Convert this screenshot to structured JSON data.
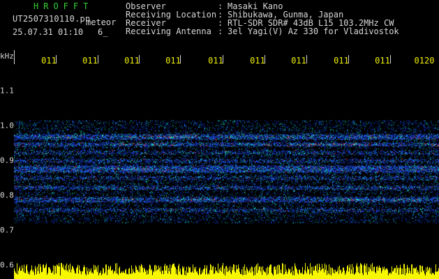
{
  "header": {
    "logo": "HROFFT",
    "filename": "UT2507310110.pn",
    "meteor": "meteor",
    "datetime": "25.07.31 01:10",
    "mark": "6_"
  },
  "info": [
    {
      "label": "Observer",
      "colon": ":",
      "value": "Masaki Kano"
    },
    {
      "label": "Receiving Location",
      "colon": ":",
      "value": "Shibukawa, Gunma, Japan"
    },
    {
      "label": "Receiver",
      "colon": ":",
      "value": "RTL-SDR SDR# 43dB L15 103.2MHz CW"
    },
    {
      "label": "Receiving Antenna",
      "colon": ":",
      "value": "3el Yagi(V) Az 330 for Vladivostok"
    }
  ],
  "time_labels": [
    "011",
    "011",
    "011",
    "011",
    "011",
    "011",
    "011",
    "011",
    "011",
    "0120"
  ],
  "y_axis": {
    "unit": "kHz",
    "labels": [
      "1.1",
      "1.0",
      "0.9",
      "0.8",
      "0.7",
      "0.6"
    ]
  },
  "colors": {
    "background": "#000000",
    "text": "#d8d8d8",
    "logo": "#32d232",
    "time": "#f0f000",
    "signal_low": "#1840ff",
    "signal_mid": "#20ffd8",
    "signal_high": "#ff4040"
  }
}
